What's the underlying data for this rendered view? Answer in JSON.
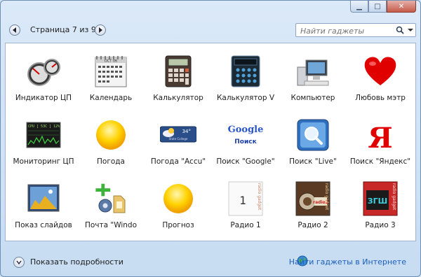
{
  "nav": {
    "page_label": "Страница 7 из 9"
  },
  "search": {
    "placeholder": "Найти гаджеты"
  },
  "gadgets": [
    {
      "label": "Индикатор ЦП",
      "icon": "cpu-meter-icon"
    },
    {
      "label": "Календарь",
      "icon": "calendar-icon"
    },
    {
      "label": "Калькулятор",
      "icon": "calculator-icon"
    },
    {
      "label": "Калькулятор V",
      "icon": "calculator-dark-icon"
    },
    {
      "label": "Компьютер",
      "icon": "computer-icon"
    },
    {
      "label": "Любовь мэтр",
      "icon": "heart-icon"
    },
    {
      "label": "Мониторинг ЦП",
      "icon": "cpu-monitor-icon"
    },
    {
      "label": "Погода",
      "icon": "sun-icon"
    },
    {
      "label": "Погода \"Accu\"",
      "icon": "weather-widget-icon"
    },
    {
      "label": "Поиск \"Google\"",
      "icon": "google-search-icon"
    },
    {
      "label": "Поиск \"Live\"",
      "icon": "live-search-icon"
    },
    {
      "label": "Поиск \"Яндекс\"",
      "icon": "yandex-search-icon"
    },
    {
      "label": "Показ слайдов",
      "icon": "slideshow-icon"
    },
    {
      "label": "Почта \"Windo",
      "icon": "mail-gadget-icon"
    },
    {
      "label": "Прогноз",
      "icon": "forecast-sun-icon"
    },
    {
      "label": "Радио 1",
      "icon": "radio-1-icon"
    },
    {
      "label": "Радио 2",
      "icon": "radio-2-icon"
    },
    {
      "label": "Радио 3",
      "icon": "radio-3-icon"
    }
  ],
  "icon_text": {
    "calendar_month": "OCT 06",
    "weather_temp": "34°",
    "weather_city": "State College",
    "google_word": "Google",
    "google_sub": "Поиск",
    "yandex_letter": "Я",
    "cpu_monitor_text": "CPU [ 53C ]   12%",
    "radio_brand": "radio gadget",
    "radio_1_num": "1",
    "radio_2_num": "radio2",
    "radio_3_num": "ЗГШ"
  },
  "footer": {
    "details_label": "Показать подробности",
    "online_link": "Найти гаджеты в Интернете"
  },
  "colors": {
    "window_bg": "#c7dcf2",
    "link": "#1b5fbd",
    "heart": "#e00000"
  }
}
